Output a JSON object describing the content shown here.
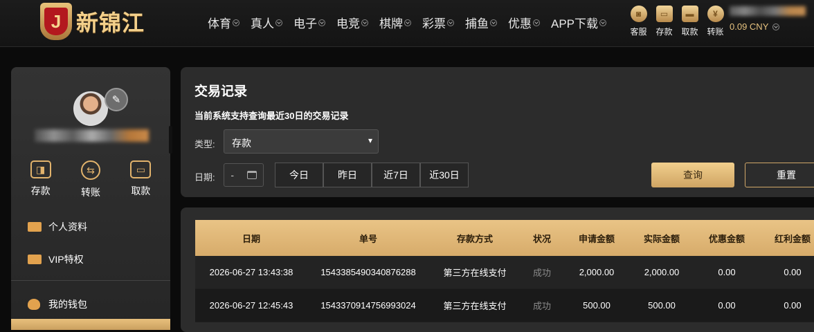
{
  "header": {
    "logo_letter": "J",
    "logo_text": "新锦江",
    "nav": [
      "体育",
      "真人",
      "电子",
      "电竞",
      "棋牌",
      "彩票",
      "捕鱼",
      "优惠",
      "APP下载"
    ],
    "quick_actions": [
      {
        "label": "客服",
        "icon": "chat-icon"
      },
      {
        "label": "存款",
        "icon": "wallet-icon"
      },
      {
        "label": "取款",
        "icon": "briefcase-icon"
      },
      {
        "label": "转账",
        "icon": "coin-icon"
      }
    ],
    "balance": "0.09 CNY"
  },
  "sidebar": {
    "wallet_actions": [
      {
        "label": "存款",
        "icon": "wallet-icon"
      },
      {
        "label": "转账",
        "icon": "transfer-icon"
      },
      {
        "label": "取款",
        "icon": "card-icon"
      }
    ],
    "menu": [
      {
        "label": "个人资料",
        "icon": "profile-card-icon"
      },
      {
        "label": "VIP特权",
        "icon": "vip-card-icon"
      },
      {
        "label": "我的钱包",
        "icon": "piggy-bank-icon"
      }
    ]
  },
  "filter": {
    "title": "交易记录",
    "subtitle": "当前系统支持查询最近30日的交易记录",
    "type_label": "类型:",
    "type_value": "存款",
    "date_label": "日期:",
    "date_value": "-",
    "quick_dates": [
      "今日",
      "昨日",
      "近7日",
      "近30日"
    ],
    "query_label": "查询",
    "reset_label": "重置"
  },
  "table": {
    "headers": [
      "日期",
      "单号",
      "存款方式",
      "状况",
      "申请金额",
      "实际金额",
      "优惠金额",
      "红利金额"
    ],
    "rows": [
      [
        "2026-06-27 13:43:38",
        "1543385490340876288",
        "第三方在线支付",
        "成功",
        "2,000.00",
        "2,000.00",
        "0.00",
        "0.00"
      ],
      [
        "2026-06-27 12:45:43",
        "1543370914756993024",
        "第三方在线支付",
        "成功",
        "500.00",
        "500.00",
        "0.00",
        "0.00"
      ]
    ]
  }
}
